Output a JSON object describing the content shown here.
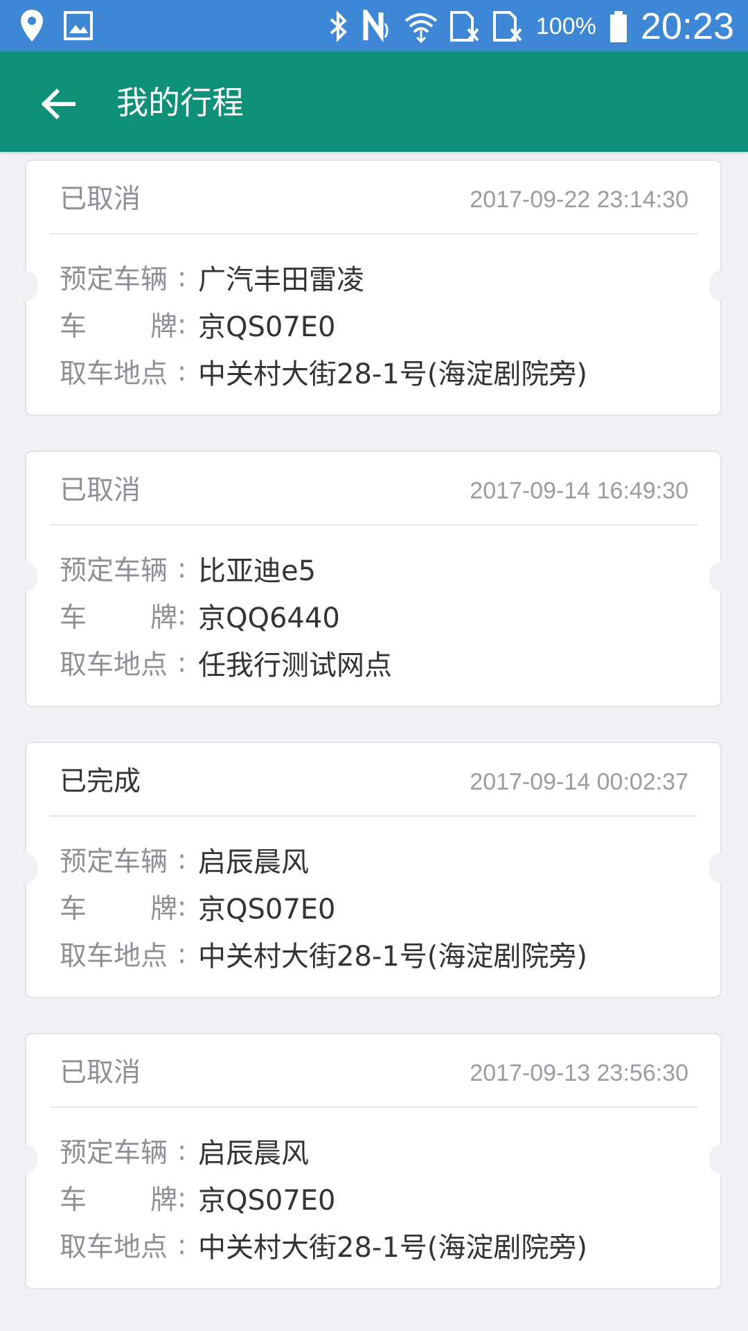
{
  "status_bar": {
    "icons_left": [
      "location-icon",
      "image-icon"
    ],
    "icons_right": [
      "bluetooth-icon",
      "nfc-icon",
      "wifi-icon",
      "sim1-no-signal-icon",
      "sim2-no-signal-icon"
    ],
    "battery_pct": "100%",
    "time": "20:23"
  },
  "app_bar": {
    "title": "我的行程",
    "background": "#0e8f78"
  },
  "labels": {
    "vehicle": "预定车辆",
    "plate_1": "车",
    "plate_2": "牌",
    "location": "取车地点",
    "colon": ":"
  },
  "trips": [
    {
      "status": "已取消",
      "time": "2017-09-22 23:14:30",
      "vehicle": "广汽丰田雷凌",
      "plate": "京QS07E0",
      "location": "中关村大街28-1号(海淀剧院旁)"
    },
    {
      "status": "已取消",
      "time": "2017-09-14 16:49:30",
      "vehicle": "比亚迪e5",
      "plate": "京QQ6440",
      "location": "任我行测试网点"
    },
    {
      "status": "已完成",
      "time": "2017-09-14 00:02:37",
      "vehicle": "启辰晨风",
      "plate": "京QS07E0",
      "location": "中关村大街28-1号(海淀剧院旁)"
    },
    {
      "status": "已取消",
      "time": "2017-09-13 23:56:30",
      "vehicle": "启辰晨风",
      "plate": "京QS07E0",
      "location": "中关村大街28-1号(海淀剧院旁)"
    }
  ]
}
